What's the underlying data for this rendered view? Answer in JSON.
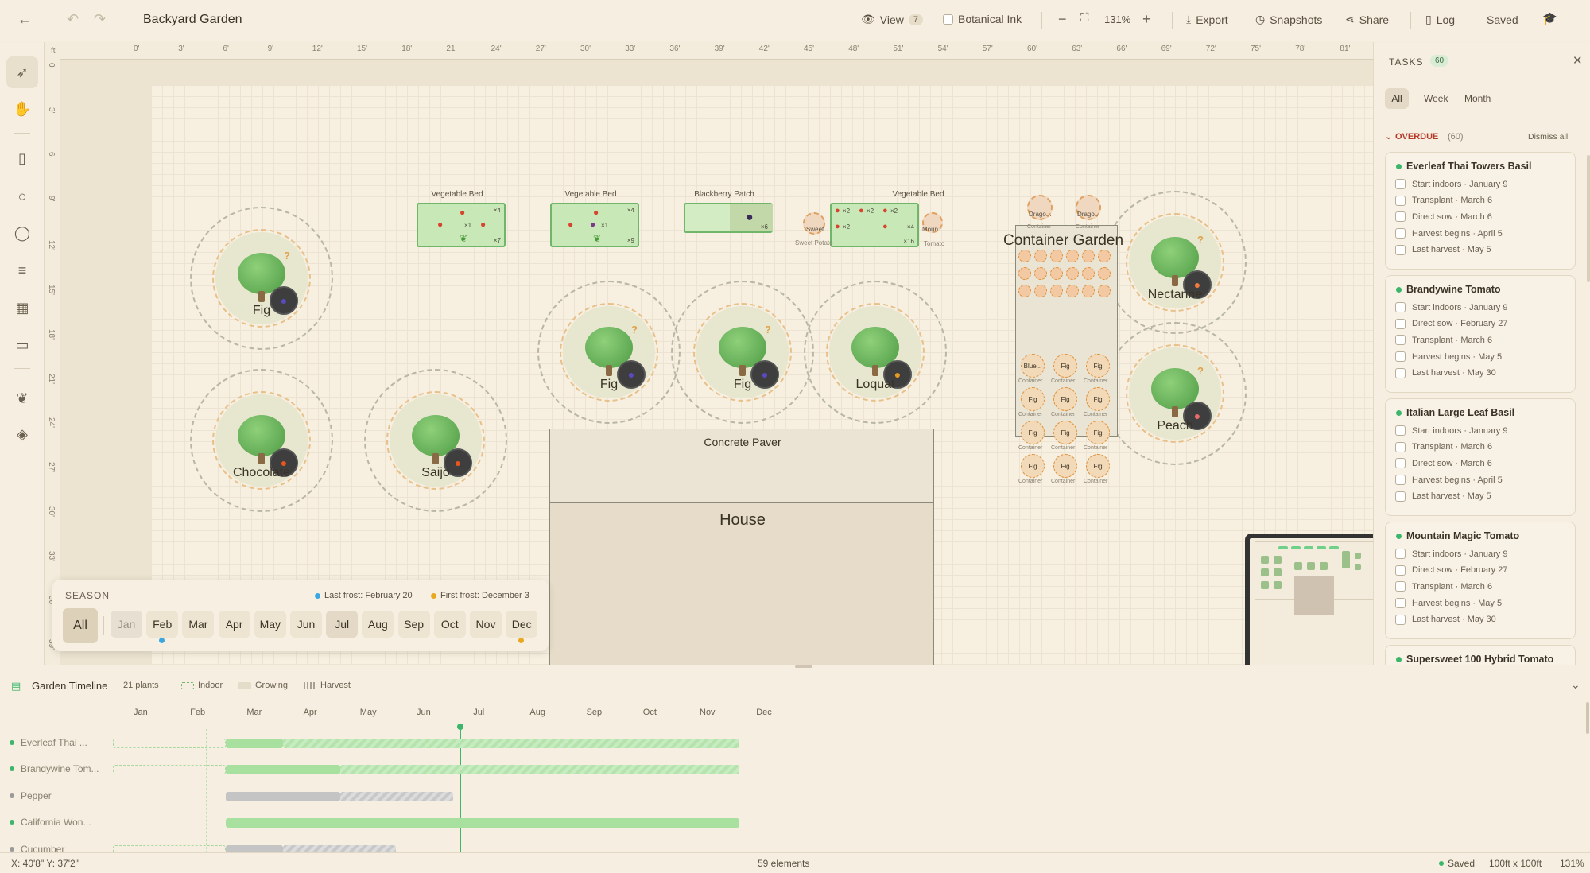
{
  "app": {
    "title": "Backyard Garden"
  },
  "topbar": {
    "view_label": "View",
    "view_count": "7",
    "botanical_ink": "Botanical Ink",
    "zoom": "131%",
    "export": "Export",
    "snapshots": "Snapshots",
    "share": "Share",
    "log": "Log",
    "saved": "Saved"
  },
  "ruler": {
    "unit": "ft",
    "top_ticks": [
      "0'",
      "3'",
      "6'",
      "9'",
      "12'",
      "15'",
      "18'",
      "21'",
      "24'",
      "27'",
      "30'",
      "33'",
      "36'",
      "39'",
      "42'",
      "45'",
      "48'",
      "51'",
      "54'",
      "57'",
      "60'",
      "63'",
      "66'",
      "69'",
      "72'",
      "75'",
      "78'",
      "81'"
    ],
    "left_ticks": [
      "0",
      "3'",
      "6'",
      "9'",
      "12'",
      "15'",
      "18'",
      "21'",
      "24'",
      "27'",
      "30'",
      "33'",
      "36'",
      "39'"
    ]
  },
  "garden": {
    "trees": [
      {
        "name": "Fig",
        "fruit": "fig"
      },
      {
        "name": "Chocolate",
        "fruit": "persimmon"
      },
      {
        "name": "Saijo",
        "fruit": "persimmon"
      },
      {
        "name": "Fig",
        "fruit": "fig"
      },
      {
        "name": "Fig",
        "fruit": "fig"
      },
      {
        "name": "Loquat",
        "fruit": "loquat"
      },
      {
        "name": "Nectarine",
        "fruit": "nectarine"
      },
      {
        "name": "Peach",
        "fruit": "peach"
      }
    ],
    "beds": [
      {
        "label": "Vegetable Bed",
        "counts": [
          "×4",
          "×1",
          "×7"
        ]
      },
      {
        "label": "Vegetable Bed",
        "counts": [
          "×4",
          "×1",
          "×9"
        ]
      },
      {
        "label": "Blackberry Patch",
        "counts": [
          "×6"
        ]
      },
      {
        "label": "Vegetable Bed",
        "counts": [
          "×2",
          "×2",
          "×2",
          "×2",
          "×4",
          "×16"
        ]
      }
    ],
    "small_labels": {
      "sweet": "Sweet",
      "sweet_potato": "Sweet Potato",
      "moun": "Moun...",
      "tomato": "Tomato",
      "drago1": "Drago...",
      "drago2": "Drago..."
    },
    "container_garden": {
      "title": "Container Garden",
      "container": "Container",
      "cells": [
        "Blue...",
        "Fig",
        "Fig",
        "Fig",
        "Fig",
        "Fig",
        "Fig",
        "Fig",
        "Fig",
        "Fig",
        "Fig",
        "Fig"
      ]
    },
    "concrete_paver": "Concrete Paver",
    "house": "House"
  },
  "season": {
    "title": "SEASON",
    "last_frost": "Last frost: February 20",
    "first_frost": "First frost: December 3",
    "all": "All",
    "months": [
      "Jan",
      "Feb",
      "Mar",
      "Apr",
      "May",
      "Jun",
      "Jul",
      "Aug",
      "Sep",
      "Oct",
      "Nov",
      "Dec"
    ],
    "colors": {
      "last_frost": "#3aa7e0",
      "first_frost": "#e8a920"
    }
  },
  "tasks": {
    "title": "TASKS",
    "count": "60",
    "tabs": [
      "All",
      "Week",
      "Month"
    ],
    "overdue_label": "OVERDUE",
    "overdue_count": "(60)",
    "dismiss_all": "Dismiss all",
    "cards": [
      {
        "title": "Everleaf Thai Towers Basil",
        "items": [
          "Start indoors · January 9",
          "Transplant · March 6",
          "Direct sow · March 6",
          "Harvest begins · April 5",
          "Last harvest · May 5"
        ]
      },
      {
        "title": "Brandywine Tomato",
        "items": [
          "Start indoors · January 9",
          "Direct sow · February 27",
          "Transplant · March 6",
          "Harvest begins · May 5",
          "Last harvest · May 30"
        ]
      },
      {
        "title": "Italian Large Leaf Basil",
        "items": [
          "Start indoors · January 9",
          "Transplant · March 6",
          "Direct sow · March 6",
          "Harvest begins · April 5",
          "Last harvest · May 5"
        ]
      },
      {
        "title": "Mountain Magic Tomato",
        "items": [
          "Start indoors · January 9",
          "Direct sow · February 27",
          "Transplant · March 6",
          "Harvest begins · May 5",
          "Last harvest · May 30"
        ]
      },
      {
        "title": "Supersweet 100 Hybrid Tomato",
        "items": []
      }
    ]
  },
  "timeline": {
    "title": "Garden Timeline",
    "plants": "21 plants",
    "legend": [
      "Indoor",
      "Growing",
      "Harvest"
    ],
    "months": [
      "Jan",
      "Feb",
      "Mar",
      "Apr",
      "May",
      "Jun",
      "Jul",
      "Aug",
      "Sep",
      "Oct",
      "Nov",
      "Dec"
    ],
    "rows": [
      {
        "name": "Everleaf Thai ...",
        "color": "#3cb66a"
      },
      {
        "name": "Brandywine Tom...",
        "color": "#3cb66a"
      },
      {
        "name": "Pepper",
        "color": "#9a9a9a"
      },
      {
        "name": "California Won...",
        "color": "#3cb66a"
      },
      {
        "name": "Cucumber",
        "color": "#9a9a9a"
      }
    ]
  },
  "status": {
    "coords": "X: 40'8\" Y: 37'2\"",
    "elements": "59 elements",
    "saved": "Saved",
    "size": "100ft x 100ft",
    "zoom": "131%"
  }
}
